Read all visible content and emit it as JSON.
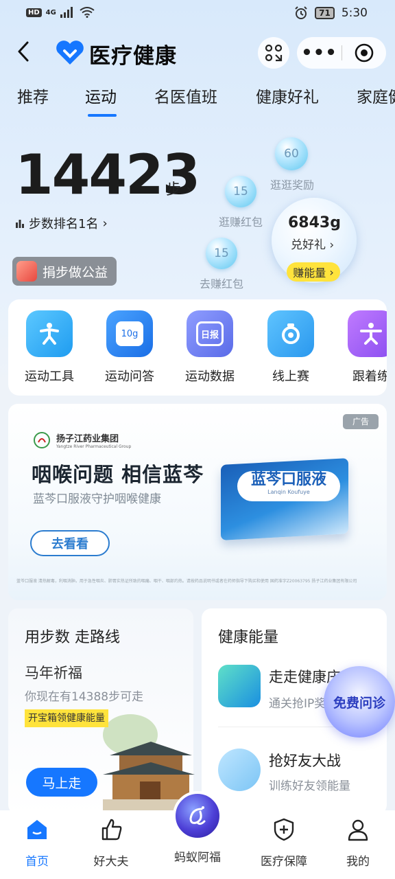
{
  "status_bar": {
    "left_badges": "HD",
    "network": "4G",
    "battery": "71",
    "time": "5:30"
  },
  "header": {
    "title": "医疗健康"
  },
  "tabs": [
    {
      "label": "推荐"
    },
    {
      "label": "运动"
    },
    {
      "label": "名医值班"
    },
    {
      "label": "健康好礼"
    },
    {
      "label": "家庭健"
    }
  ],
  "active_tab_index": 1,
  "steps": {
    "count": "14423",
    "unit": "步",
    "rank": "步数排名1名",
    "donate": "捐步做公益"
  },
  "bubbles": [
    {
      "value": "60",
      "label": "逛逛奖励"
    },
    {
      "value": "15",
      "label": "逛赚红包"
    },
    {
      "value": "15",
      "label": "去赚红包"
    }
  ],
  "energy": {
    "value": "6843g",
    "sub": "兑好礼",
    "button": "赚能量"
  },
  "tools": [
    {
      "label": "运动工具",
      "icon": "running-person-icon",
      "color": "#2fb0f5"
    },
    {
      "label": "运动问答",
      "icon": "qa-bubble-icon",
      "color": "#2b86f0",
      "badge": "10g"
    },
    {
      "label": "运动数据",
      "icon": "daily-report-icon",
      "color": "#6b7df2",
      "badge": "日报"
    },
    {
      "label": "线上赛",
      "icon": "medal-icon",
      "color": "#3aaef2"
    },
    {
      "label": "跟着练",
      "icon": "exercise-icon",
      "color": "#9c5ff0"
    }
  ],
  "ad": {
    "tag": "广告",
    "brand": "扬子江药业集团",
    "brand_en": "Yangtze River Pharmaceutical Group",
    "headline": "咽喉问题 相信蓝芩",
    "sub": "蓝芩口服液守护咽喉健康",
    "button": "去看看",
    "product": "蓝芩口服液",
    "product_pinyin": "Lanqin Koufuye",
    "fine_print": "蓝芩口服液 清热解毒，利咽消肿。用于急性咽炎、肺胃实热证所致的咽痛、咽干、咽部灼热。请按药品说明书或者在药师指导下购买和使用 国药准字Z20063795 扬子江药业集团有限公司"
  },
  "walk_card": {
    "title": "用步数 走路线",
    "subtitle": "马年祈福",
    "desc": "你现在有14388步可走",
    "tag": "开宝箱领健康能量",
    "button": "马上走"
  },
  "energy_card": {
    "title": "健康能量",
    "items": [
      {
        "title": "走走健康庄",
        "sub": "通关抢IP奖"
      },
      {
        "title": "抢好友大战",
        "sub": "训练好友领能量"
      }
    ]
  },
  "consult": "免费问诊",
  "bottom_nav": [
    {
      "label": "首页",
      "icon": "home-icon"
    },
    {
      "label": "好大夫",
      "icon": "thumbs-up-icon"
    },
    {
      "label": "蚂蚁阿福",
      "icon": "afu-icon"
    },
    {
      "label": "医疗保障",
      "icon": "shield-plus-icon"
    },
    {
      "label": "我的",
      "icon": "person-icon"
    }
  ],
  "colors": {
    "accent": "#1677ff",
    "energy_yellow": "#ffe33c"
  }
}
